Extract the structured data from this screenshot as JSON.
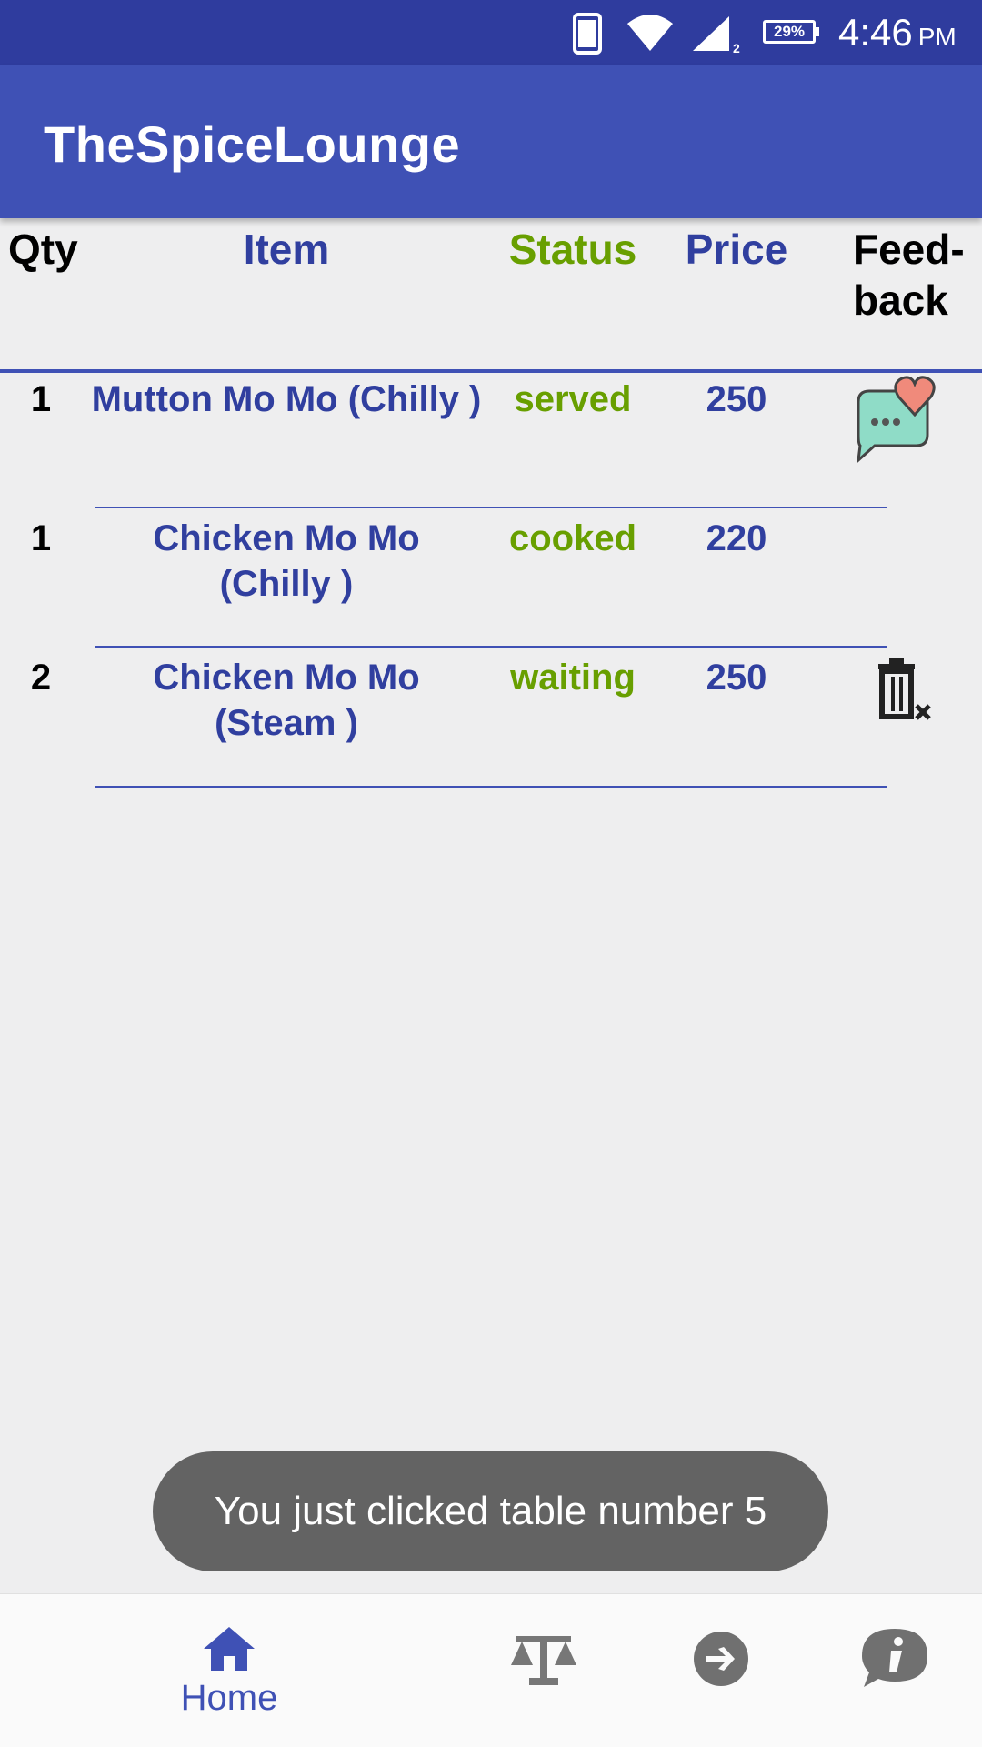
{
  "status_bar": {
    "battery": "29%",
    "time": "4:46",
    "ampm": "PM",
    "icons": [
      "phone-icon",
      "wifi-icon",
      "signal-icon",
      "battery-icon"
    ]
  },
  "app_bar": {
    "title": "TheSpiceLounge"
  },
  "table": {
    "headers": {
      "qty": "Qty",
      "item": "Item",
      "status": "Status",
      "price": "Price",
      "feedback": "Feed-back"
    },
    "rows": [
      {
        "qty": "1",
        "item": "Mutton Mo Mo (Chilly )",
        "status": "served",
        "price": "250",
        "action": "feedback-icon"
      },
      {
        "qty": "1",
        "item": "Chicken Mo Mo (Chilly )",
        "status": "cooked",
        "price": "220",
        "action": ""
      },
      {
        "qty": "2",
        "item": "Chicken Mo Mo (Steam )",
        "status": "waiting",
        "price": "250",
        "action": "delete-icon"
      }
    ]
  },
  "toast": {
    "text": "You just clicked table number 5"
  },
  "bottom_nav": {
    "home_label": "Home",
    "items": [
      "home-icon",
      "scales-icon",
      "arrow-right-icon",
      "info-icon"
    ],
    "active_color": "#3f51b5"
  },
  "colors": {
    "primary": "#3f51b5",
    "primary_dark": "#2f3c9e",
    "status_green": "#689f00",
    "text_blue": "#303f9f"
  }
}
